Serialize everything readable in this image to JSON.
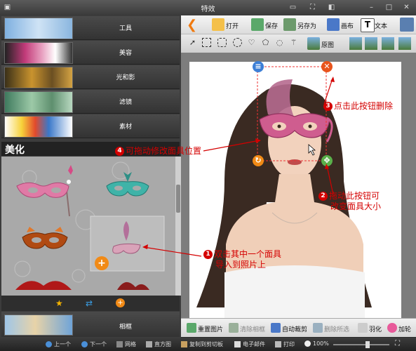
{
  "window": {
    "title": "特效"
  },
  "categories": [
    {
      "label": "工具"
    },
    {
      "label": "美容"
    },
    {
      "label": "光和影"
    },
    {
      "label": "滤镜"
    },
    {
      "label": "素材"
    }
  ],
  "section": {
    "title": "美化"
  },
  "frame_category": {
    "label": "相框"
  },
  "toolbar": {
    "open": "打开",
    "save": "保存",
    "save_as": "另存为",
    "canvas": "画布",
    "text": "文本",
    "original": "原图"
  },
  "bottom_toolbar": {
    "reset": "重置图片",
    "clear_frame": "清除相框",
    "auto_crop": "自动裁剪",
    "remove_effects": "删除所选",
    "feather": "羽化",
    "add_border": "加轮"
  },
  "statusbar": {
    "prev": "上一个",
    "next": "下一个",
    "grid": "网格",
    "histogram": "直方图",
    "copy_clipboard": "复制到剪切板",
    "email": "电子邮件",
    "print": "打印",
    "zoom": "100%"
  },
  "callouts": [
    {
      "num": "1",
      "text": "双击其中一个面具",
      "text2": "导入到照片上"
    },
    {
      "num": "2",
      "text": "拖动此按钮可",
      "text2": "改变面具大小"
    },
    {
      "num": "3",
      "text": "点击此按钮删除"
    },
    {
      "num": "4",
      "text": "可拖动修改面具位置"
    }
  ],
  "colors": {
    "accent": "#d40000",
    "toolbar": "#e6e6e6",
    "panel": "#3c3c3c"
  }
}
